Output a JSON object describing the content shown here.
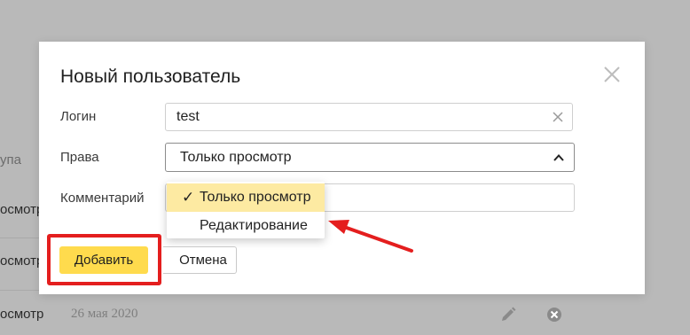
{
  "background": {
    "column_header_fragment": "упа",
    "row_fragments": [
      "осмотр",
      "осмотр",
      "осмотр"
    ],
    "last_row_date": "26 мая 2020",
    "row_icons": [
      "pencil-icon",
      "delete-circle-icon"
    ]
  },
  "modal": {
    "title": "Новый пользователь",
    "close_icon": "close-icon",
    "fields": {
      "login_label": "Логин",
      "login_value": "test",
      "rights_label": "Права",
      "rights_value": "Только просмотр",
      "comment_label": "Комментарий",
      "comment_value": ""
    },
    "dropdown": {
      "options": [
        {
          "label": "Только просмотр",
          "selected": true
        },
        {
          "label": "Редактирование",
          "selected": false
        }
      ],
      "check_glyph": "✓"
    },
    "buttons": {
      "add_label": "Добавить",
      "cancel_label": "Отмена"
    }
  },
  "colors": {
    "overlay": "#b9b9b9",
    "primary_button": "#ffdb4d",
    "selected_option": "#fdeaa2",
    "annotation_red": "#e41e1e"
  }
}
